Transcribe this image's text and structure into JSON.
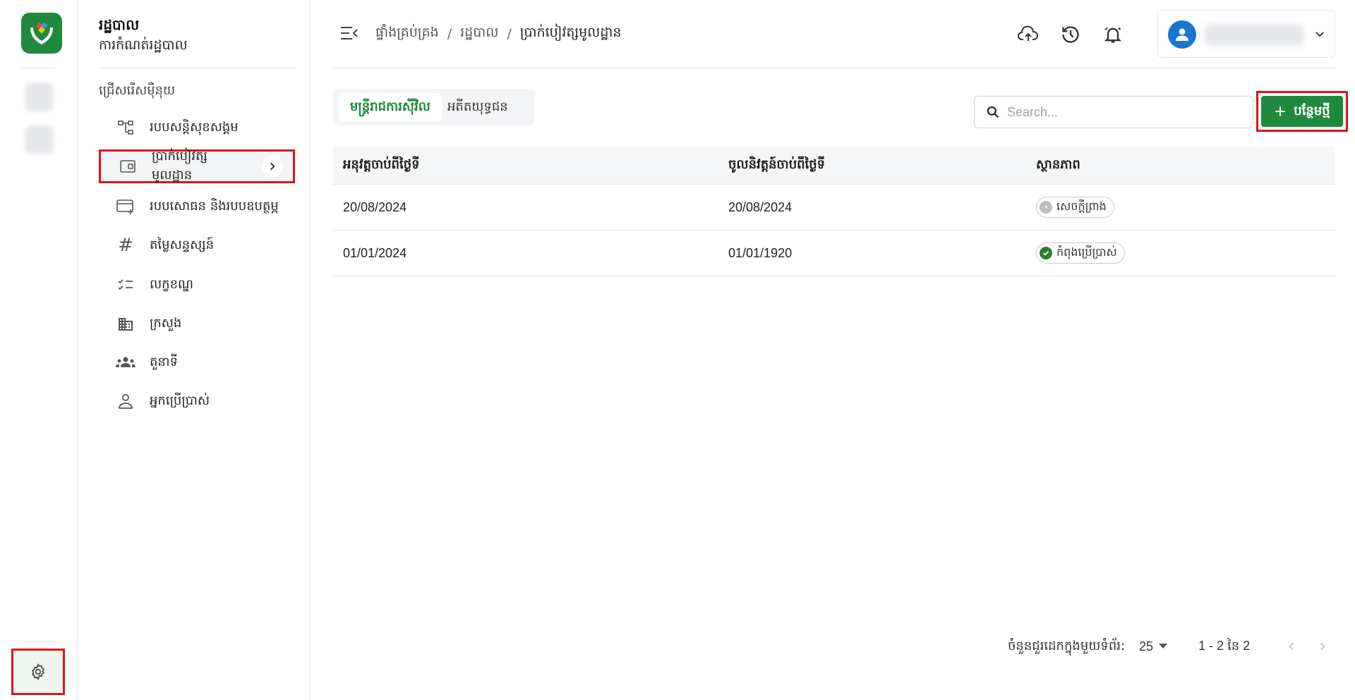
{
  "rail": {
    "settings_icon": "gear-icon"
  },
  "sidebar": {
    "title": "រដ្ឋបាល",
    "subtitle": "ការកំណត់រដ្ឋបាល",
    "menu_label": "ជ្រើសរើសម៉ឺនុយ",
    "items": [
      {
        "label": "របបសន្តិសុខសង្គម",
        "icon": "hierarchy-icon"
      },
      {
        "label": "ប្រាក់បៀវត្សមូលដ្ឋាន",
        "icon": "wallet-icon",
        "active": true
      },
      {
        "label": "របបសោធន និងរបបឧបត្ថម្ភ",
        "icon": "card-add-icon"
      },
      {
        "label": "តម្លៃសន្ទស្សន៍",
        "icon": "hash-icon"
      },
      {
        "label": "លក្ខខណ្ឌ",
        "icon": "checklist-icon"
      },
      {
        "label": "ក្រសួង",
        "icon": "building-icon"
      },
      {
        "label": "តួនាទី",
        "icon": "group-icon"
      },
      {
        "label": "អ្នកប្រើប្រាស់",
        "icon": "person-icon"
      }
    ]
  },
  "header": {
    "breadcrumb": [
      "ផ្ទាំងគ្រប់គ្រង",
      "រដ្ឋបាល",
      "ប្រាក់បៀវត្សមូលដ្ឋាន"
    ],
    "icons": [
      "cloud-upload-icon",
      "history-icon",
      "bell-icon"
    ]
  },
  "tabs": [
    {
      "label": "មន្ត្រីរាជការស៊ីវិល",
      "active": true
    },
    {
      "label": "អតីតយុទ្ធជន",
      "active": false
    }
  ],
  "search": {
    "placeholder": "Search..."
  },
  "add_button": {
    "label": "បន្ថែមថ្មី"
  },
  "table": {
    "headers": [
      "អនុវត្តចាប់ពីថ្ងៃទី",
      "ចូលនិវត្តន៍ចាប់ពីថ្ងៃទី",
      "ស្ថានភាព"
    ],
    "rows": [
      {
        "apply_from": "20/08/2024",
        "retire_from": "20/08/2024",
        "status": "សេចក្តីព្រាង",
        "status_type": "draft"
      },
      {
        "apply_from": "01/01/2024",
        "retire_from": "01/01/1920",
        "status": "កំពុងប្រើប្រាស់",
        "status_type": "active"
      }
    ]
  },
  "pagination": {
    "rows_per_page_label": "ចំនួនជួរដេកក្នុងមួយទំព័រ:",
    "rows_per_page": "25",
    "range": "1 - 2 នៃ 2"
  },
  "colors": {
    "brand": "#1f8a3e",
    "highlight": "#e0131a",
    "avatar": "#1976d2"
  }
}
